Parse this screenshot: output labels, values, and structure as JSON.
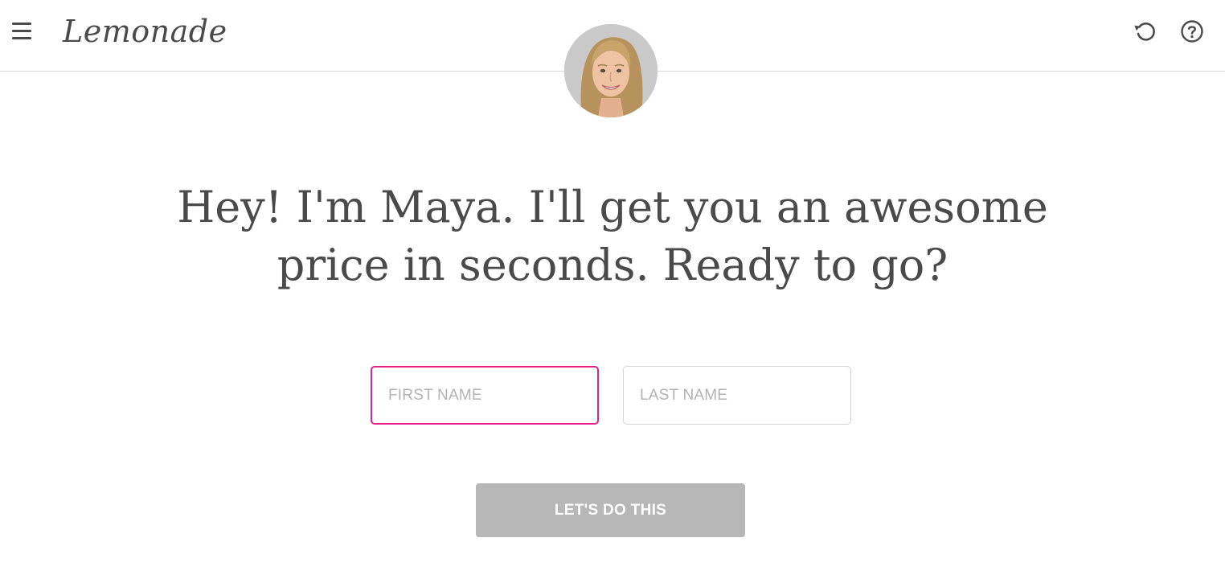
{
  "header": {
    "logo_text": "Lemonade",
    "menu_icon": "hamburger-menu-icon",
    "restart_icon": "restart-icon",
    "help_icon": "help-icon"
  },
  "bot": {
    "avatar_icon": "bot-avatar-photo"
  },
  "main": {
    "headline_line1": "Hey! I'm Maya. I'll get you an awesome",
    "headline_line2": "price in seconds. Ready to go?",
    "first_name": {
      "placeholder": "FIRST NAME",
      "value": ""
    },
    "last_name": {
      "placeholder": "LAST NAME",
      "value": ""
    },
    "submit_label": "LET'S DO THIS"
  },
  "colors": {
    "accent_focus": "#e4208b",
    "text": "#4a4a4a",
    "button_disabled": "#b7b7b7",
    "divider": "#d6d6d6"
  }
}
